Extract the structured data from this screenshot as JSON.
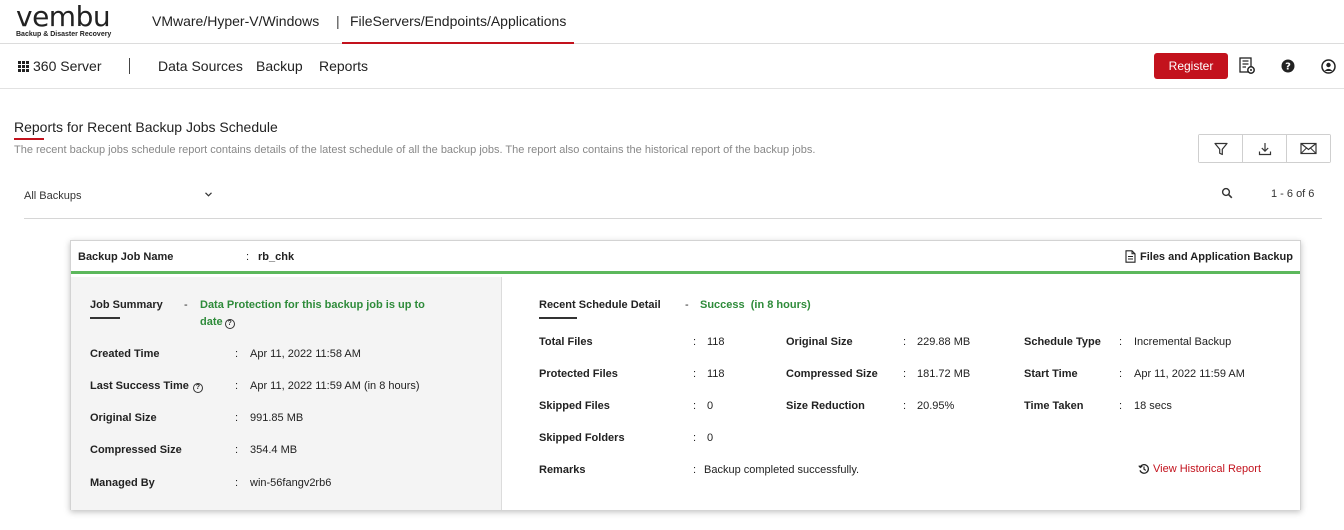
{
  "brand": {
    "name": "vembu",
    "tagline": "Backup & Disaster Recovery"
  },
  "top_tabs": [
    {
      "label": "VMware/Hyper-V/Windows",
      "active": false
    },
    {
      "label": "FileServers/Endpoints/Applications",
      "active": true
    }
  ],
  "top_separator": "|",
  "navbar": {
    "server_label": "360 Server",
    "items": [
      "Data Sources",
      "Backup",
      "Reports"
    ],
    "register_label": "Register",
    "icons": [
      "settings-list-icon",
      "help-icon",
      "user-icon"
    ]
  },
  "page": {
    "title": "Reports for Recent Backup Jobs Schedule",
    "description": "The recent backup jobs schedule report contains details of the latest schedule of all the backup jobs. The report also contains the historical report of the backup jobs.",
    "actions": [
      "filter-icon",
      "download-icon",
      "mail-icon"
    ]
  },
  "filter": {
    "selected": "All Backups",
    "pagination": "1 - 6 of 6"
  },
  "card": {
    "job_name_label": "Backup Job Name",
    "job_name_colon": ":",
    "job_name": "rb_chk",
    "backup_type": "Files and Application Backup",
    "summary": {
      "label": "Job Summary",
      "dash": "-",
      "status_line1": "Data Protection for this backup job is up to",
      "status_line2": "date",
      "rows": [
        {
          "label": "Created Time",
          "value": "Apr 11, 2022 11:58 AM"
        },
        {
          "label": "Last Success Time",
          "value": "Apr 11, 2022 11:59 AM (in 8 hours)"
        },
        {
          "label": "Original Size",
          "value": "991.85 MB"
        },
        {
          "label": "Compressed Size",
          "value": "354.4 MB"
        },
        {
          "label": "Managed By",
          "value": "win-56fangv2rb6"
        }
      ]
    },
    "recent": {
      "label": "Recent Schedule Detail",
      "dash": "-",
      "status": "Success  (in 8 hours)",
      "col1": [
        {
          "label": "Total Files",
          "value": "118"
        },
        {
          "label": "Protected Files",
          "value": "118"
        },
        {
          "label": "Skipped Files",
          "value": "0"
        },
        {
          "label": "Skipped Folders",
          "value": "0"
        }
      ],
      "col2": [
        {
          "label": "Original Size",
          "value": "229.88 MB"
        },
        {
          "label": "Compressed Size",
          "value": "181.72 MB"
        },
        {
          "label": "Size Reduction",
          "value": "20.95%"
        }
      ],
      "col3": [
        {
          "label": "Schedule Type",
          "value": "Incremental Backup"
        },
        {
          "label": "Start Time",
          "value": "Apr 11, 2022 11:59 AM"
        },
        {
          "label": "Time Taken",
          "value": "18 secs"
        }
      ],
      "remarks_label": "Remarks",
      "remarks_value": "Backup completed successfully.",
      "history_link": "View Historical Report"
    }
  },
  "colors": {
    "accent": "#c3121d",
    "success": "#2e8b3a",
    "card_border": "#5cb85c"
  }
}
